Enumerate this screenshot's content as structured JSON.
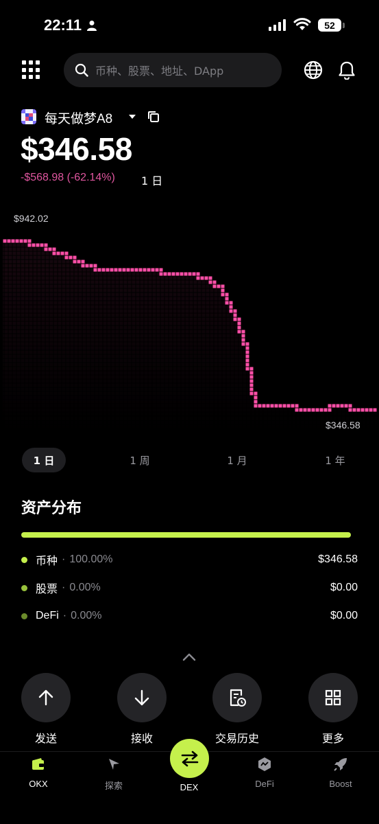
{
  "status_bar": {
    "time": "22:11",
    "battery": "52"
  },
  "search": {
    "placeholder": "币种、股票、地址、DApp"
  },
  "wallet": {
    "name": "每天做梦A8",
    "balance": "$346.58",
    "change": "-$568.98 (-62.14%)",
    "period": "1 日"
  },
  "chart": {
    "max_label": "$942.02",
    "min_label": "$346.58",
    "line_color": "#ff4fa8"
  },
  "chart_data": {
    "type": "line",
    "title": "",
    "xlabel": "",
    "ylabel": "",
    "y_max_label": "$942.02",
    "y_min_label": "$346.58",
    "ylim": [
      346.58,
      942.02
    ],
    "values": [
      942.02,
      942,
      940,
      930,
      915,
      900,
      880,
      865,
      850,
      845,
      850,
      848,
      848,
      846,
      830,
      832,
      832,
      825,
      810,
      780,
      700,
      600,
      370,
      368,
      365,
      362,
      360,
      360,
      360,
      362,
      362,
      358,
      355,
      346.58
    ]
  },
  "ranges": [
    {
      "label": "1 日",
      "active": true
    },
    {
      "label": "1 周",
      "active": false
    },
    {
      "label": "1 月",
      "active": false
    },
    {
      "label": "1 年",
      "active": false
    }
  ],
  "assets": {
    "title": "资产分布",
    "bar_color": "#c5f04c",
    "rows": [
      {
        "name": "币种",
        "pct": "100.00%",
        "value": "$346.58",
        "dot": "#c5f04c"
      },
      {
        "name": "股票",
        "pct": "0.00%",
        "value": "$0.00",
        "dot": "#98c23c"
      },
      {
        "name": "DeFi",
        "pct": "0.00%",
        "value": "$0.00",
        "dot": "#6b8b2b"
      }
    ]
  },
  "actions": [
    {
      "label": "发送",
      "icon": "arrow-up-icon"
    },
    {
      "label": "接收",
      "icon": "arrow-down-icon"
    },
    {
      "label": "交易历史",
      "icon": "history-icon"
    },
    {
      "label": "更多",
      "icon": "grid-icon"
    }
  ],
  "nav": [
    {
      "label": "OKX",
      "icon": "wallet-icon",
      "active": true
    },
    {
      "label": "探索",
      "icon": "compass-icon",
      "active": false
    },
    {
      "label": "DEX",
      "icon": "swap-icon",
      "active": false
    },
    {
      "label": "DeFi",
      "icon": "defi-icon",
      "active": false
    },
    {
      "label": "Boost",
      "icon": "rocket-icon",
      "active": false
    }
  ],
  "colors": {
    "accent": "#c5f04c",
    "negative": "#e0569f",
    "background": "#000000"
  }
}
